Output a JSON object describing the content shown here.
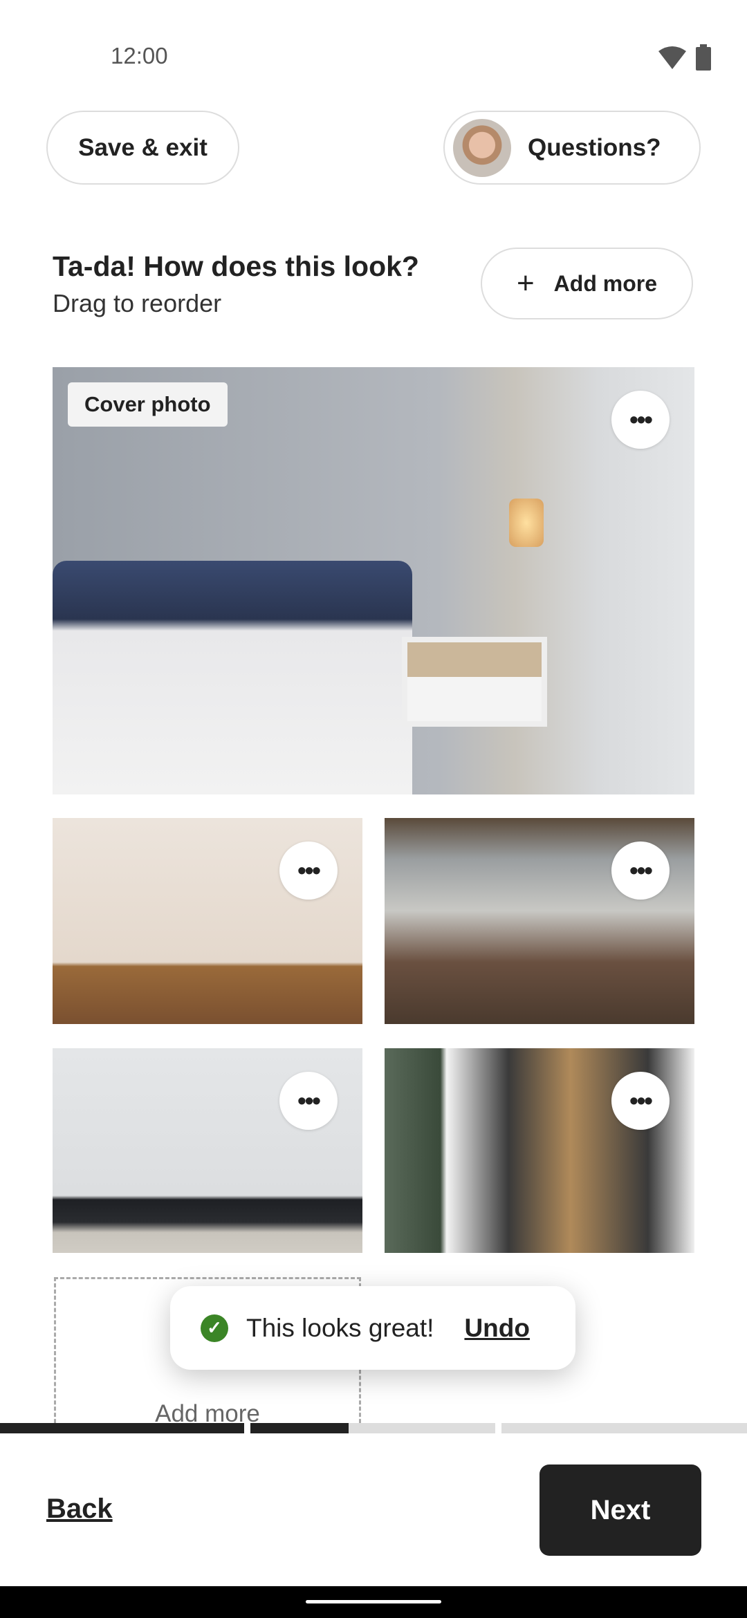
{
  "status_bar": {
    "time": "12:00",
    "icons": [
      "wifi-icon",
      "battery-icon"
    ]
  },
  "header": {
    "save_exit": "Save & exit",
    "questions": "Questions?"
  },
  "heading": {
    "title": "Ta-da! How does this look?",
    "subtitle": "Drag to reorder",
    "add_more": "Add more",
    "add_icon": "+"
  },
  "photos": {
    "cover_label": "Cover photo",
    "more_icon": "•••",
    "items": [
      "bedroom",
      "living-room",
      "loft-living-room",
      "minimal-living-room",
      "apartment-exterior"
    ]
  },
  "add_tile": {
    "label": "Add more"
  },
  "toast": {
    "message": "This looks great!",
    "action": "Undo",
    "icon": "✓"
  },
  "progress": {
    "step1": 1.0,
    "step2": 0.4,
    "step3": 0,
    "step4": 0
  },
  "footer": {
    "back": "Back",
    "next": "Next"
  }
}
